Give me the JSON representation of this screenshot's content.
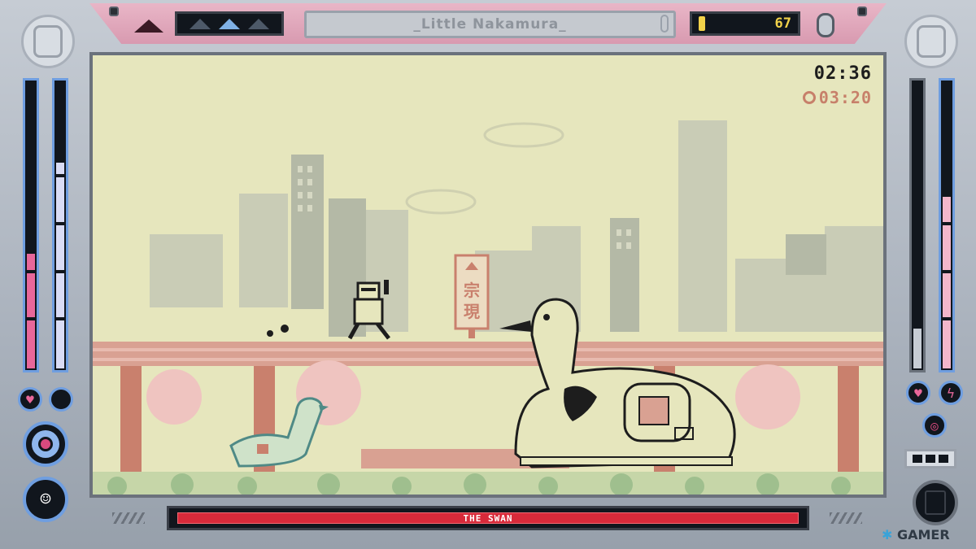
{
  "hud": {
    "level_title": "_Little Nakamura_",
    "lives": {
      "total": 3,
      "active_index": 1
    },
    "coins": "67",
    "timer": "02:36",
    "best_time": "03:20",
    "boss_name": "THE SWAN",
    "boss_health_fraction": 1.0
  },
  "left_panel": {
    "meter_a": {
      "fraction": 0.4,
      "color": "#e8679a"
    },
    "meter_b": {
      "fraction": 0.72,
      "color": "#d9dcf5"
    },
    "icons": [
      "heart-icon",
      "empty-slot-icon",
      "target-icon",
      "player-portrait-icon"
    ]
  },
  "right_panel": {
    "meter_a": {
      "fraction": 0.14,
      "color": "#c6ccd4"
    },
    "meter_b": {
      "fraction": 0.6,
      "color": "#f3b6cb"
    },
    "icons": [
      "heart-icon",
      "lightning-icon",
      "ring-icon",
      "card-icon"
    ]
  },
  "scene": {
    "sign_text": [
      "宗",
      "現"
    ],
    "palette": {
      "bg": "#e6e6bd",
      "building": "#b9bfae",
      "rail": "#d9a192",
      "pillar": "#c9806d",
      "ink": "#1d1d1d",
      "tree": "#efc4c0",
      "grass": "#9fbf8e"
    }
  },
  "watermark": {
    "prefix": "",
    "text": "GAMER"
  }
}
